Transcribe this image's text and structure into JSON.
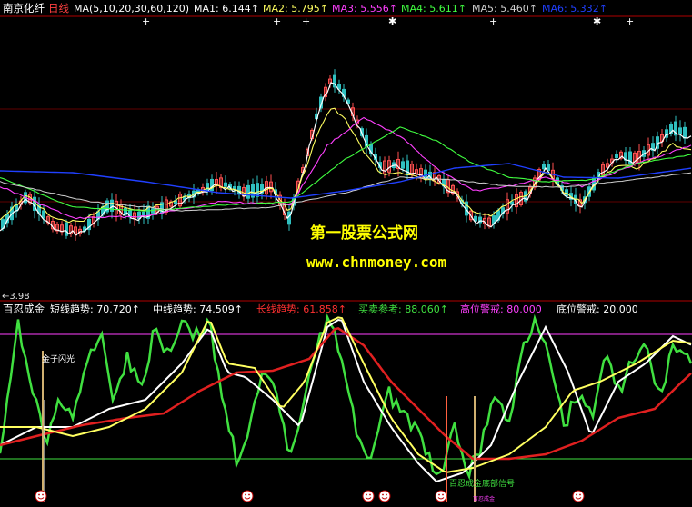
{
  "colors": {
    "background": "#000000",
    "separator": "#b00000",
    "price_up": "#ff5050",
    "price_down": "#30c0c0",
    "ma1": "#ffffff",
    "ma2": "#ffff60",
    "ma3": "#ff40ff",
    "ma4": "#40ff40",
    "ma5": "#d0d0d0",
    "ma6": "#2040ff",
    "short_trend": "#40e040",
    "mid_trend": "#ffffff",
    "long_trend": "#e02020",
    "buy_ref": "#ffff60",
    "high_warn": "#ff40ff",
    "low_warn": "#40e040",
    "watermark_title": "#ffff00",
    "watermark_url": "#ffff00"
  },
  "header_main": {
    "stock_name": "南京化纤",
    "period": "日线",
    "ma_def": "MA(5,10,20,30,60,120)",
    "ma1": "MA1: 6.144↑",
    "ma2": "MA2: 5.795↑",
    "ma3": "MA3: 5.556↑",
    "ma4": "MA4: 5.611↑",
    "ma5": "MA5: 5.460↑",
    "ma6": "MA6: 5.332↑"
  },
  "header_indicator": {
    "name": "百忍成金",
    "short_trend": "短线趋势: 70.720↑",
    "mid_trend": "中线趋势: 74.509↑",
    "long_trend": "长线趋势: 61.858↑",
    "buy_ref": "买卖参考: 88.060↑",
    "high_warn": "高位警戒: 80.000",
    "low_warn": "底位警戒: 20.000"
  },
  "low_price_label": "←3.98",
  "annotations": {
    "golden_flash": "金子闪光",
    "bottom_signal": "百忍成金底部信号",
    "bottom_small": "百忍成金"
  },
  "watermark": {
    "title": "第一股票公式网",
    "url": "www.chnmoney.com"
  },
  "chart_data": [
    {
      "type": "candlestick",
      "title": "南京化纤 日线",
      "ylim": [
        3.9,
        7.4
      ],
      "low_label": 3.98,
      "series": [
        {
          "name": "MA1",
          "last": 6.144
        },
        {
          "name": "MA2",
          "last": 5.795
        },
        {
          "name": "MA3",
          "last": 5.556
        },
        {
          "name": "MA4",
          "last": 5.611
        },
        {
          "name": "MA5",
          "last": 5.46
        },
        {
          "name": "MA6",
          "last": 5.332
        }
      ]
    },
    {
      "type": "line",
      "title": "百忍成金",
      "ylim": [
        0,
        100
      ],
      "high_line": 80,
      "low_line": 20,
      "series": [
        {
          "name": "短线趋势",
          "last": 70.72
        },
        {
          "name": "中线趋势",
          "last": 74.509
        },
        {
          "name": "长线趋势",
          "last": 61.858
        },
        {
          "name": "买卖参考",
          "last": 88.06
        }
      ]
    }
  ]
}
